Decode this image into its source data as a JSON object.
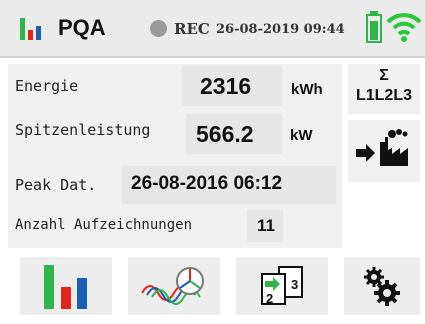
{
  "header": {
    "app_title": "PQA",
    "rec_label": "REC",
    "datetime": "26-08-2019 09:44",
    "logo_icon": "pqa-bar-logo",
    "battery_icon": "battery-icon",
    "wifi_icon": "wifi-icon"
  },
  "measurements": {
    "energie": {
      "label": "Energie",
      "value": "2316",
      "unit": "kWh"
    },
    "spitzen": {
      "label": "Spitzenleistung",
      "value": "566.2",
      "unit": "kW"
    },
    "peak": {
      "label": "Peak Dat.",
      "value": "26-08-2016 06:12"
    },
    "anzahl": {
      "label": "Anzahl Aufzeichnungen",
      "value": "11"
    }
  },
  "side": {
    "sigma": "Σ",
    "phases": "L1L2L3",
    "factory_icon": "export-to-factory-icon"
  },
  "toolbar": [
    {
      "name": "bar-chart-button",
      "icon": "bar-chart-icon"
    },
    {
      "name": "waveform-phasor-button",
      "icon": "waveform-phasor-icon"
    },
    {
      "name": "pages-button",
      "icon": "pages-icon",
      "page_a": "2",
      "page_b": "3"
    },
    {
      "name": "settings-button",
      "icon": "gears-icon"
    }
  ],
  "colors": {
    "green": "#2fb54a",
    "red": "#e2231a",
    "blue": "#1a5fb4",
    "wifi": "#29c93a"
  }
}
